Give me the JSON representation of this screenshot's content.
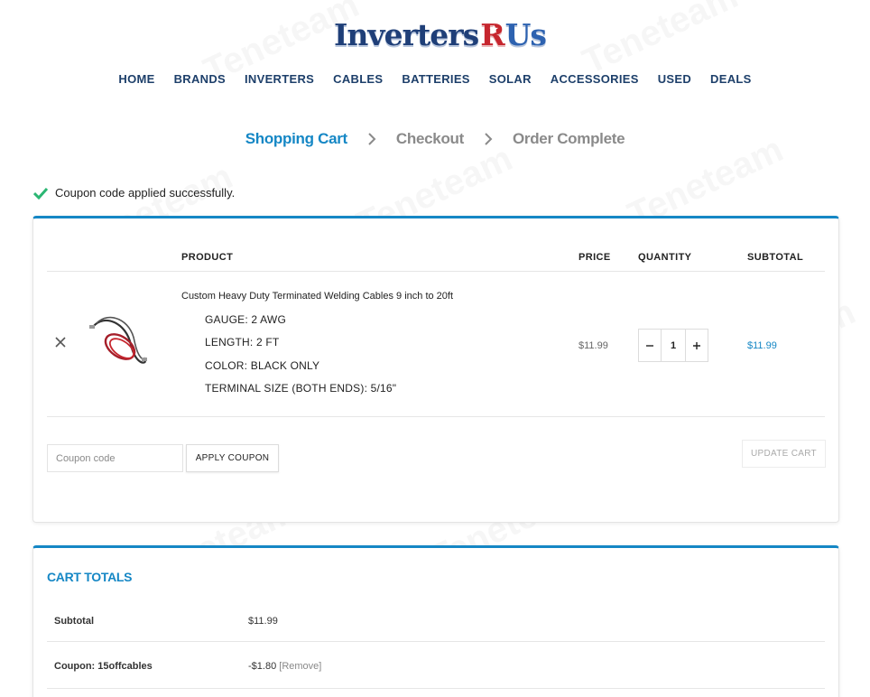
{
  "logo": {
    "part1": "Inverters",
    "part2": "R",
    "part3": "Us"
  },
  "nav": [
    "HOME",
    "BRANDS",
    "INVERTERS",
    "CABLES",
    "BATTERIES",
    "SOLAR",
    "ACCESSORIES",
    "USED",
    "DEALS"
  ],
  "steps": {
    "cart": "Shopping Cart",
    "checkout": "Checkout",
    "complete": "Order Complete"
  },
  "notice": "Coupon code applied successfully.",
  "cart": {
    "headers": {
      "product": "PRODUCT",
      "price": "PRICE",
      "quantity": "QUANTITY",
      "subtotal": "SUBTOTAL"
    },
    "item": {
      "name": "Custom Heavy Duty Terminated Welding Cables 9 inch to 20ft",
      "attributes": [
        "GAUGE: 2 AWG",
        "LENGTH: 2 FT",
        "COLOR: BLACK ONLY",
        "TERMINAL SIZE (BOTH ENDS): 5/16\""
      ],
      "price": "$11.99",
      "quantity": "1",
      "subtotal": "$11.99"
    },
    "coupon_placeholder": "Coupon code",
    "apply_label": "APPLY COUPON",
    "update_label": "UPDATE CART"
  },
  "totals": {
    "title": "CART TOTALS",
    "subtotal_label": "Subtotal",
    "subtotal_value": "$11.99",
    "coupon_label": "Coupon: 15offcables",
    "coupon_value": "-$1.80",
    "coupon_remove": "[Remove]"
  },
  "watermark": "Teneteam",
  "colors": {
    "accent": "#1587c5",
    "nav": "#1d3f6a",
    "success": "#2bb673"
  }
}
